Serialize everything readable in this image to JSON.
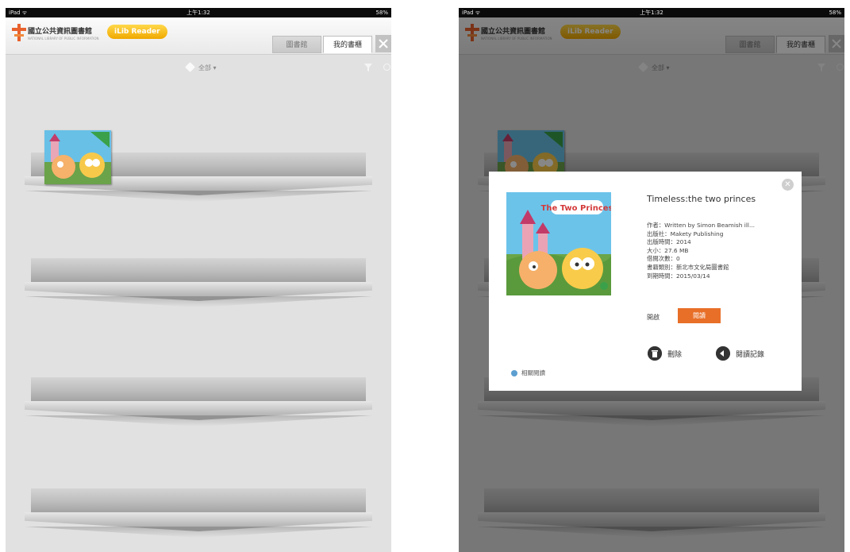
{
  "status_bar": {
    "carrier": "iPad ᯤ",
    "time": "上午1:32",
    "battery": "58%"
  },
  "header": {
    "library_name": "國立公共資訊圖書館",
    "library_name_en": "NATIONAL LIBRARY OF PUBLIC INFORMATION",
    "app_badge": "iLib Reader",
    "tabs": [
      {
        "label": "圖書館"
      },
      {
        "label": "我的書櫃"
      }
    ],
    "active_tab": 1,
    "settings_icon": "wrench-screwdriver-icon"
  },
  "filter": {
    "label": "全部 ▾",
    "filter_icon": "funnel-icon",
    "refresh_icon": "refresh-icon"
  },
  "shelves": {
    "count": 4
  },
  "book": {
    "title": "Timeless:the two princes",
    "cover_title": "The Two Princes",
    "details": [
      "作者：Written by Simon Beamish ill...",
      "出版社：Makety Publishing",
      "出版時間：2014",
      "大小：27.6 MB",
      "借閱次數：0",
      "書籍類別：新北市文化局圖書館",
      "到期時間：2015/03/14"
    ],
    "read_label": "開啟",
    "read_button": "閱讀",
    "delete_label": "刪除",
    "record_label": "閱讀記錄",
    "related_label": "相關閱讀"
  },
  "colors": {
    "accent": "#e86f28",
    "badge": "#f5b400",
    "link": "#5c9fd0"
  }
}
